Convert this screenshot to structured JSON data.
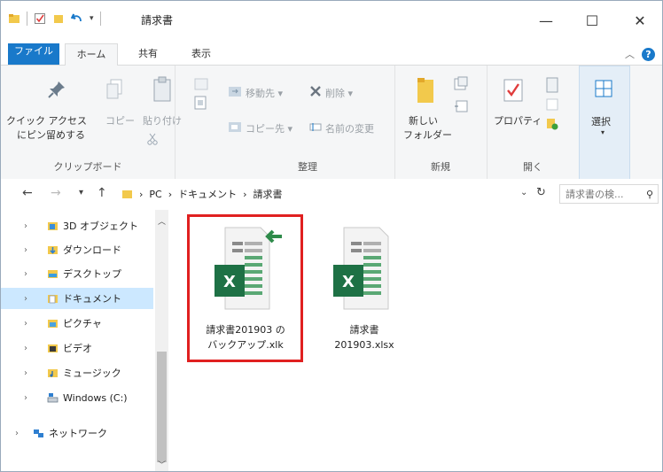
{
  "window": {
    "title": "請求書",
    "minimize": "—",
    "maximize": "☐",
    "close": "✕"
  },
  "tabs": [
    {
      "label": "ファイル"
    },
    {
      "label": "ホーム"
    },
    {
      "label": "共有"
    },
    {
      "label": "表示"
    }
  ],
  "ribbon": {
    "clipboard": {
      "label": "クリップボード",
      "quick_access_line1": "クイック アクセス",
      "quick_access_line2": "にピン留めする",
      "copy": "コピー",
      "paste": "貼り付け"
    },
    "organize": {
      "label": "整理",
      "move_to": "移動先 ▾",
      "delete": "削除 ▾",
      "copy_to": "コピー先 ▾",
      "rename": "名前の変更"
    },
    "new": {
      "label": "新規",
      "new_folder_line1": "新しい",
      "new_folder_line2": "フォルダー"
    },
    "open": {
      "label": "開く",
      "properties": "プロパティ"
    },
    "select": {
      "label": "選択"
    }
  },
  "address": {
    "segments": [
      "PC",
      "ドキュメント",
      "請求書"
    ],
    "search_placeholder": "請求書の検..."
  },
  "sidebar": {
    "items": [
      {
        "label": "3D オブジェクト",
        "color": "#3b8ed8"
      },
      {
        "label": "ダウンロード",
        "color": "#2f7fd0"
      },
      {
        "label": "デスクトップ",
        "color": "#3a9ee0"
      },
      {
        "label": "ドキュメント",
        "color": "#8e9aa8",
        "selected": true
      },
      {
        "label": "ピクチャ",
        "color": "#4aa3df"
      },
      {
        "label": "ビデオ",
        "color": "#3a3a3a"
      },
      {
        "label": "ミュージック",
        "color": "#f0a020"
      },
      {
        "label": "Windows (C:)",
        "color": "#6a7a8a"
      },
      {
        "label": "ネットワーク",
        "color": "#2f7fd0"
      }
    ]
  },
  "files": [
    {
      "line1": "請求書201903 の",
      "line2": "バックアップ.xlk",
      "selected": true
    },
    {
      "line1": "請求書",
      "line2": "201903.xlsx",
      "selected": false
    }
  ],
  "colors": {
    "accent": "#1979ca",
    "excel_green": "#1e7145",
    "highlight": "#e02020",
    "selection": "#cce8ff"
  }
}
